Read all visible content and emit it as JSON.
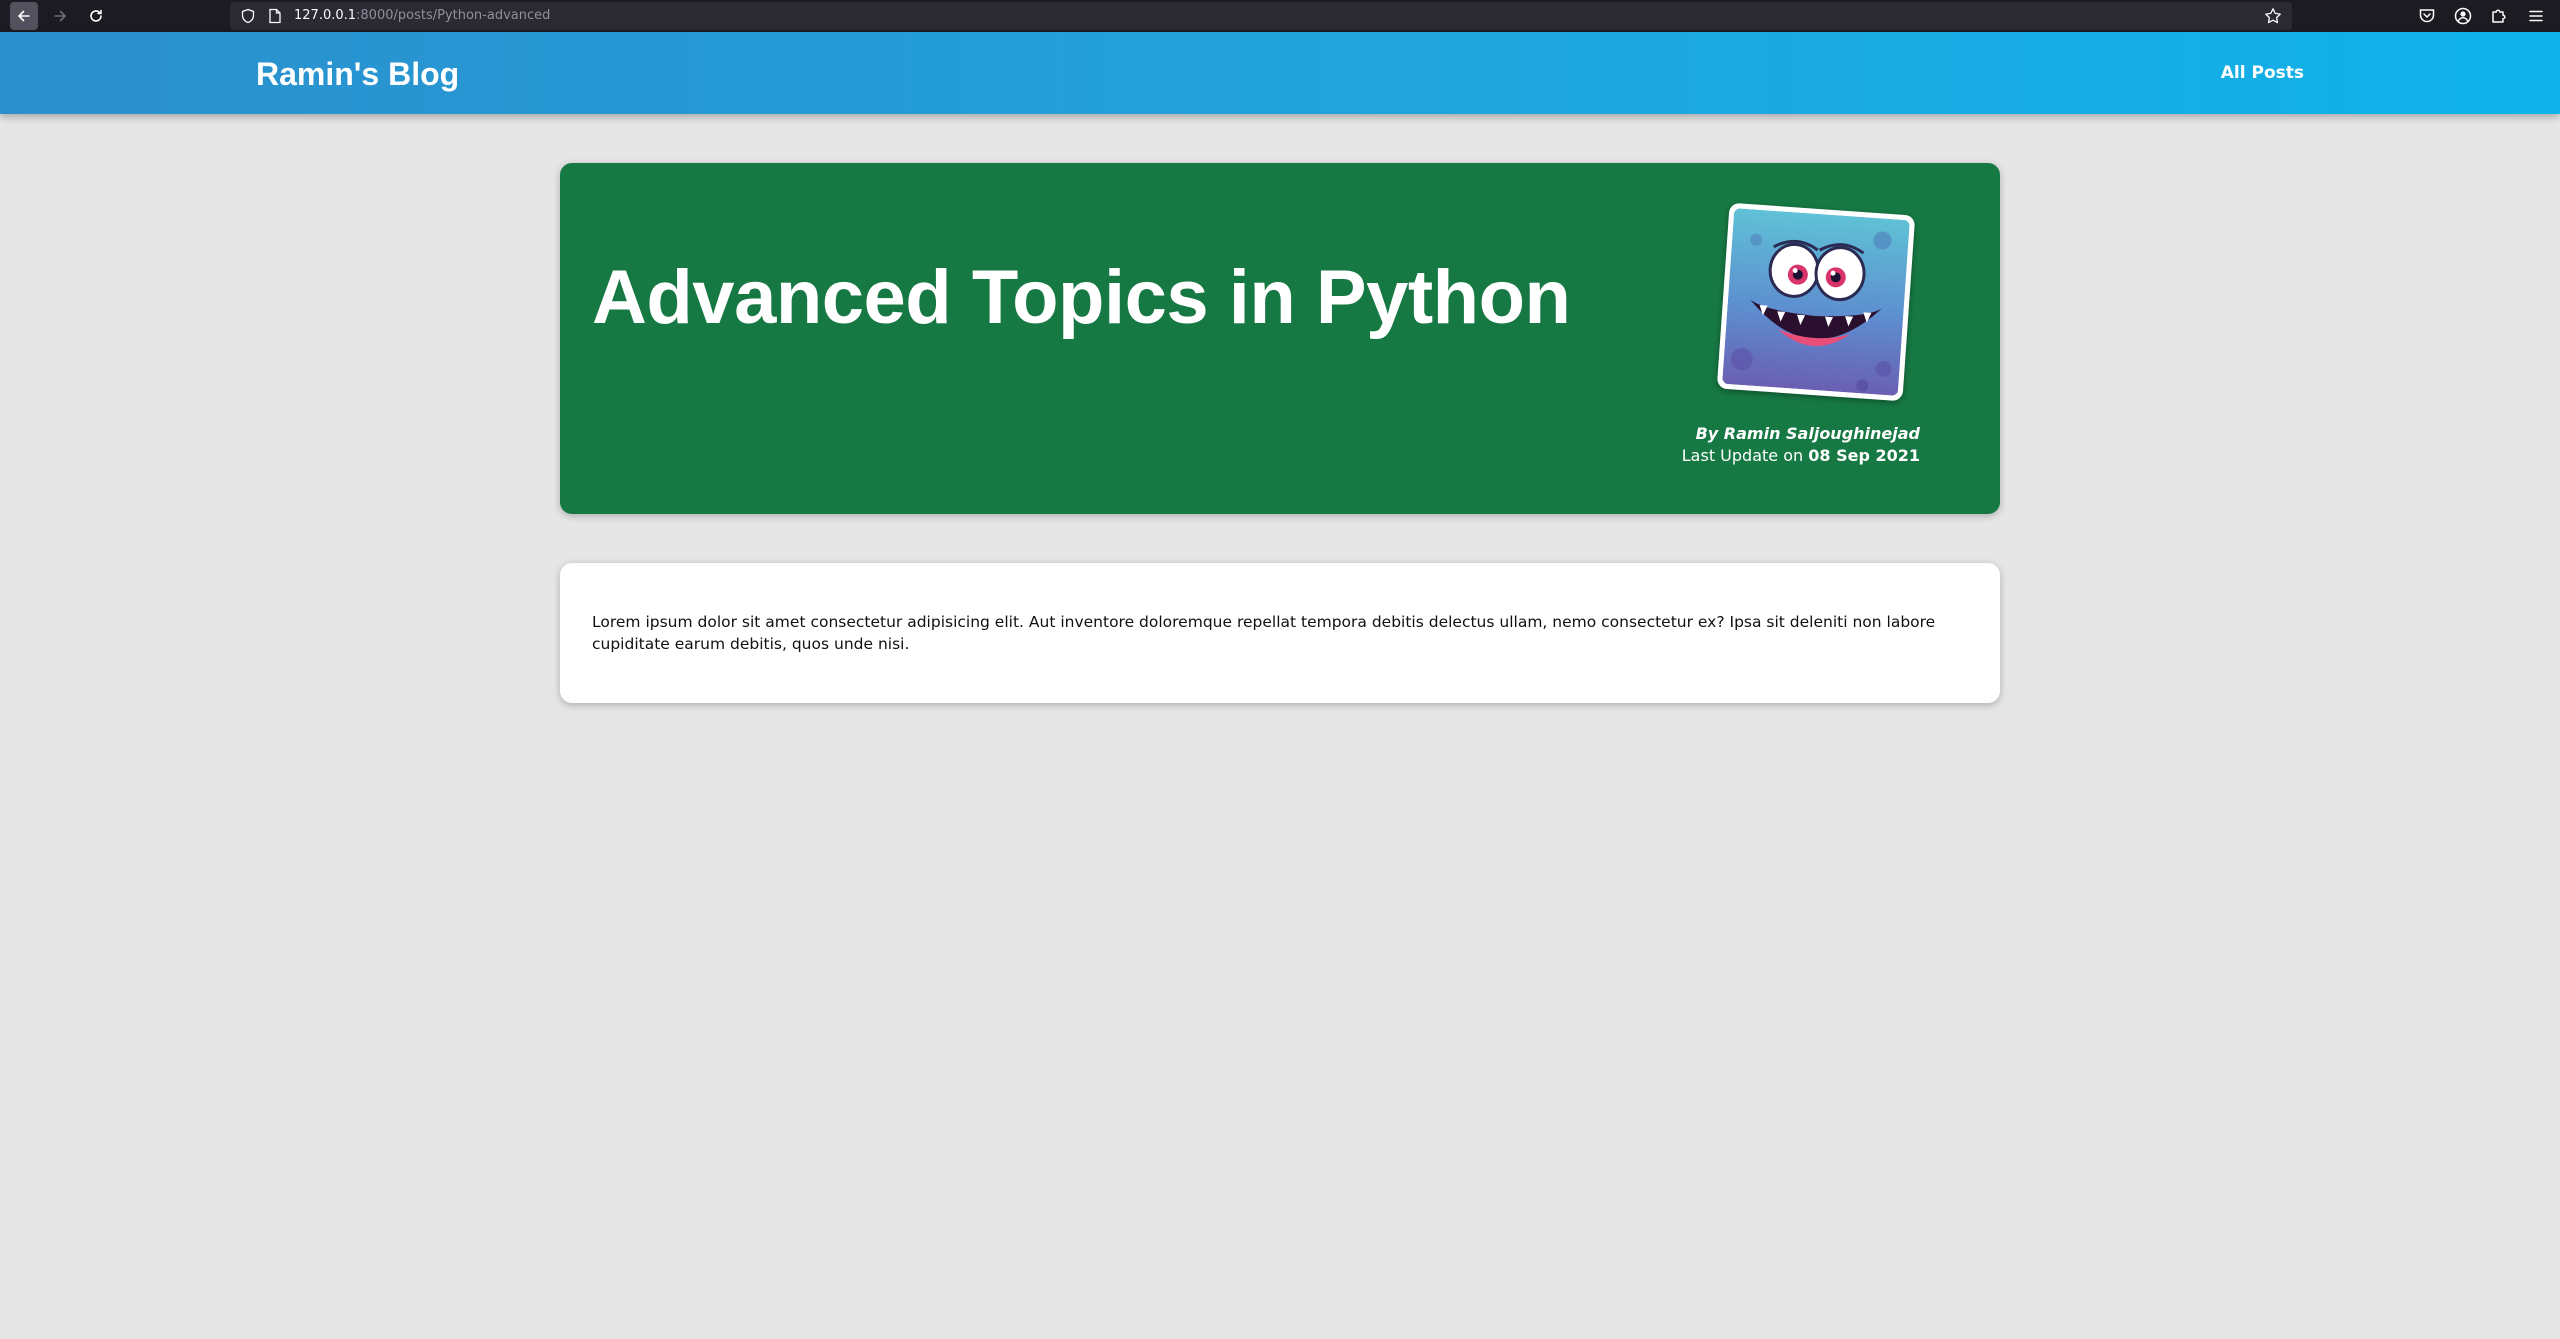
{
  "browser": {
    "url_host": "127.0.0.1",
    "url_rest": ":8000/posts/Python-advanced",
    "theme": "#1c1b22"
  },
  "header": {
    "site_title": "Ramin's Blog",
    "nav_link": "All Posts",
    "colors": {
      "gradient_start": "#2b8fcd",
      "gradient_end": "#0fb2ea"
    }
  },
  "post": {
    "title": "Advanced Topics in Python",
    "author": "By Ramin Saljoughinejad",
    "update_label": "Last Update on",
    "update_date": "08 Sep 2021",
    "image_icon": "monster-avatar",
    "hero_color": "#167843",
    "content": "Lorem ipsum dolor sit amet consectetur adipisicing elit. Aut inventore doloremque repellat tempora debitis delectus ullam, nemo consectetur ex? Ipsa sit deleniti non labore cupiditate earum debitis, quos unde nisi."
  }
}
